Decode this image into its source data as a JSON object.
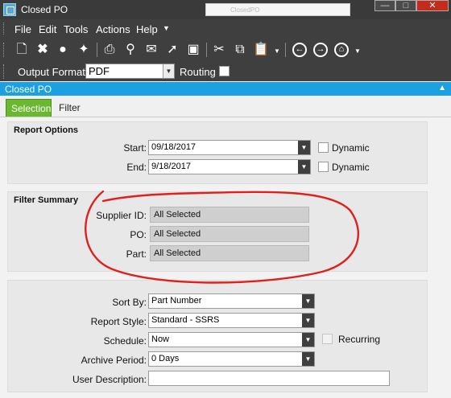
{
  "window": {
    "title": "Closed PO",
    "ghost_title": "ClosedPO"
  },
  "menu": {
    "items": [
      "File",
      "Edit",
      "Tools",
      "Actions",
      "Help"
    ]
  },
  "toolbar": {
    "icons": [
      "new-icon",
      "delete-icon",
      "comment-icon",
      "clear-icon",
      "print-icon",
      "print-preview-icon",
      "send-icon",
      "generate-icon",
      "image-icon",
      "cut-icon",
      "copy-icon",
      "paste-icon",
      "back-icon",
      "forward-icon",
      "home-icon"
    ]
  },
  "format_bar": {
    "output_label": "Output Format:",
    "output_value": "PDF",
    "routing_label": "Routing"
  },
  "panel": {
    "title": "Closed PO"
  },
  "tabs": {
    "selection": "Selection",
    "filter": "Filter"
  },
  "report_options": {
    "title": "Report Options",
    "start_label": "Start:",
    "start_value": "09/18/2017",
    "end_label": "End:",
    "end_value": "9/18/2017",
    "dynamic_label": "Dynamic"
  },
  "filter_summary": {
    "title": "Filter Summary",
    "supplier_label": "Supplier ID:",
    "supplier_value": "All Selected",
    "po_label": "PO:",
    "po_value": "All Selected",
    "part_label": "Part:",
    "part_value": "All Selected"
  },
  "report_settings": {
    "sort_label": "Sort By:",
    "sort_value": "Part Number",
    "style_label": "Report Style:",
    "style_value": "Standard - SSRS",
    "schedule_label": "Schedule:",
    "schedule_value": "Now",
    "recurring_label": "Recurring",
    "archive_label": "Archive Period:",
    "archive_value": "0 Days",
    "user_desc_label": "User Description:",
    "user_desc_value": ""
  },
  "colors": {
    "accent": "#1ca0e0",
    "tab_active": "#6ab82f",
    "annotation": "#e0201c",
    "chrome": "#3f3f3f"
  }
}
